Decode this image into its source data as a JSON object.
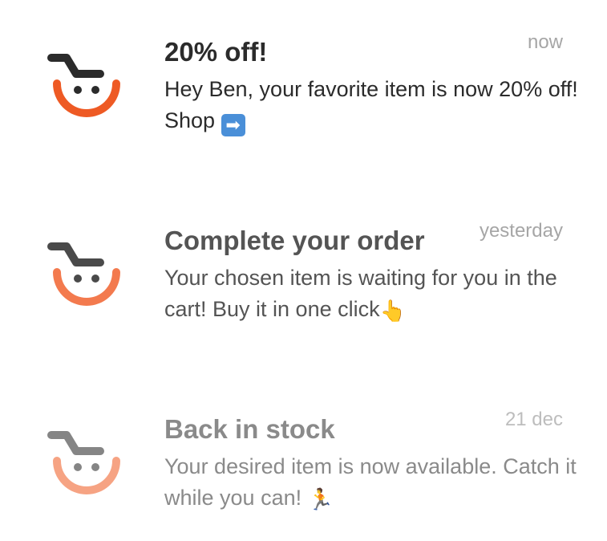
{
  "notifications": [
    {
      "title": "20% off!",
      "body": "Hey Ben, your favorite item is now 20% off! Shop",
      "emoji": "➡",
      "time": "now",
      "icon": "shopping-cart-icon",
      "colors": {
        "smile": "#ee5a24",
        "cart": "#2b2b2b"
      }
    },
    {
      "title": "Complete your order",
      "body": "Your chosen item is waiting for you in the cart! Buy it in one click",
      "emoji": "👆",
      "time": "yesterday",
      "icon": "shopping-cart-icon",
      "colors": {
        "smile": "#f37a4e",
        "cart": "#4a4a4a"
      }
    },
    {
      "title": "Back in stock",
      "body": "Your desired item is now available. Catch it while you can!",
      "emoji": "🏃",
      "time": "21 dec",
      "icon": "shopping-cart-icon",
      "colors": {
        "smile": "#f6a383",
        "cart": "#858585"
      }
    }
  ]
}
